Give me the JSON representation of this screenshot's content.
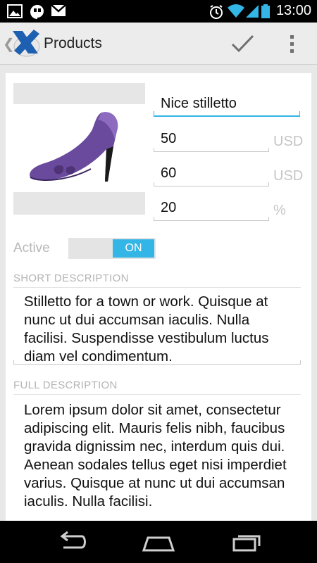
{
  "status_bar": {
    "time": "13:00",
    "left_icons": [
      "picture-notification-icon",
      "hangouts-notification-icon",
      "gmail-notification-icon"
    ],
    "right_icons": [
      "alarm-icon",
      "wifi-icon",
      "cell-signal-icon",
      "battery-icon"
    ]
  },
  "action_bar": {
    "title": "Products",
    "up_icon": "chevron-left-icon",
    "logo_icon": "app-logo-icon",
    "actions": [
      "checkmark-icon",
      "overflow-menu-icon"
    ]
  },
  "product": {
    "name": "Nice stilletto",
    "price": "50",
    "price_unit": "USD",
    "list_price": "60",
    "list_price_unit": "USD",
    "discount": "20",
    "discount_unit": "%",
    "image_icon": "purple-stiletto-shoe-image"
  },
  "active": {
    "label": "Active",
    "state": "ON"
  },
  "short_description": {
    "header": "SHORT DESCRIPTION",
    "text": "Stilletto for a town or work. Quisque at nunc ut dui accumsan iaculis. Nulla facilisi. Suspendisse vestibulum luctus diam vel condimentum."
  },
  "full_description": {
    "header": "FULL DESCRIPTION",
    "text": "Lorem ipsum dolor sit amet, consectetur adipiscing elit. Mauris felis nibh, faucibus gravida dignissim nec, interdum quis dui. Aenean sodales tellus eget nisi imperdiet varius. Quisque at nunc ut dui accumsan iaculis. Nulla facilisi."
  },
  "nav_bar": {
    "buttons": [
      "back-icon",
      "home-icon",
      "recent-apps-icon"
    ]
  },
  "colors": {
    "accent": "#33b5e5",
    "action_bar_bg": "#ececec",
    "background": "#e8e8e8",
    "shoe": "#6a4a9c"
  }
}
